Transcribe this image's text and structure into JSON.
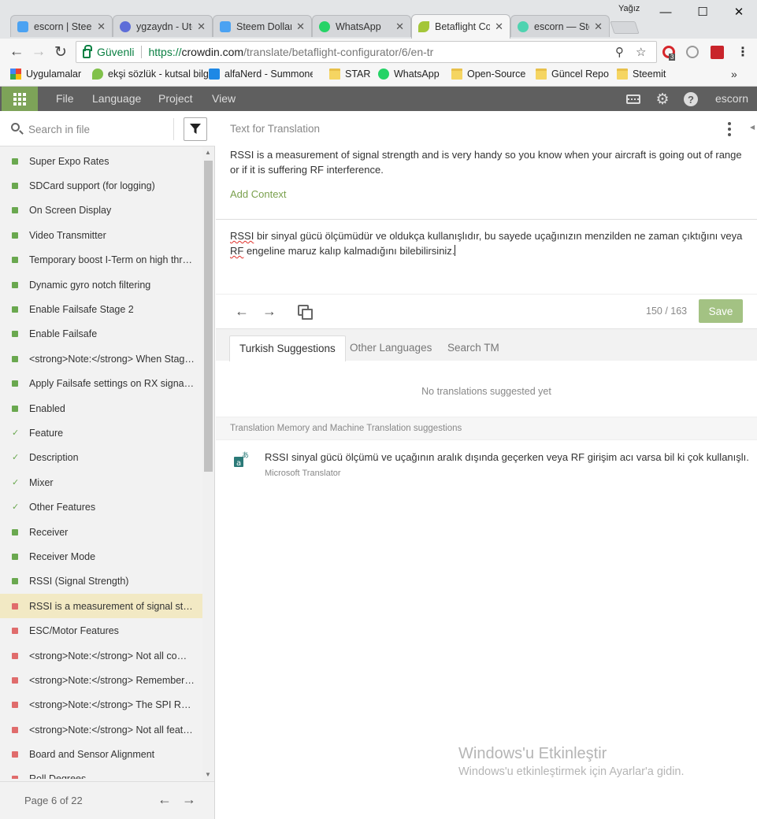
{
  "window": {
    "user": "Yağız",
    "controls": {
      "minimize": "—",
      "maximize": "☐",
      "close": "✕"
    }
  },
  "tabs": [
    {
      "label": "escorn | Steemit",
      "color": "#4ba2f2"
    },
    {
      "label": "ygzaydn - Utopian",
      "color": "#5d6dd8"
    },
    {
      "label": "Steem Dollars",
      "color": "#4ba2f2"
    },
    {
      "label": "WhatsApp",
      "color": "#25d366"
    },
    {
      "label": "Betaflight Configurator",
      "color": "#a4c639"
    },
    {
      "label": "escorn — Steemit",
      "color": "#4fd3b0"
    }
  ],
  "address_bar": {
    "secure_label": "Güvenli",
    "scheme": "https://",
    "host": "crowdin.com",
    "path": "/translate/betaflight-configurator/6/en-tr",
    "extension_badge": "3"
  },
  "bookmarks": [
    {
      "label": "Uygulamalar",
      "icon": "apps-icon"
    },
    {
      "label": "ekşi sözlük - kutsal bilgi",
      "icon": "eksi-icon"
    },
    {
      "label": "alfaNerd - Summoner",
      "icon": "alfanerd-icon"
    },
    {
      "label": "STAR",
      "icon": "folder-icon"
    },
    {
      "label": "WhatsApp",
      "icon": "whatsapp-icon"
    },
    {
      "label": "Open-Source",
      "icon": "folder-icon"
    },
    {
      "label": "Güncel Repo",
      "icon": "folder-icon"
    },
    {
      "label": "Steemit",
      "icon": "folder-icon"
    }
  ],
  "bookmarks_more": "»",
  "app_menu": [
    "File",
    "Language",
    "Project",
    "View"
  ],
  "app_user": "escorn",
  "sidebar": {
    "search_placeholder": "Search in file",
    "items": [
      {
        "label": "Super Expo Rates",
        "status": "green"
      },
      {
        "label": "SDCard support (for logging)",
        "status": "green"
      },
      {
        "label": "On Screen Display",
        "status": "green"
      },
      {
        "label": "Video Transmitter",
        "status": "green"
      },
      {
        "label": "Temporary boost I-Term on high throttle changes",
        "status": "green"
      },
      {
        "label": "Dynamic gyro notch filtering",
        "status": "green"
      },
      {
        "label": "Enable Failsafe Stage 2",
        "status": "green"
      },
      {
        "label": "Enable Failsafe",
        "status": "green"
      },
      {
        "label": "<strong>Note:</strong> When Stage 2 is",
        "status": "green"
      },
      {
        "label": "Apply Failsafe settings on RX signal loss",
        "status": "green"
      },
      {
        "label": "Enabled",
        "status": "green"
      },
      {
        "label": "Feature",
        "status": "check"
      },
      {
        "label": "Description",
        "status": "check"
      },
      {
        "label": "Mixer",
        "status": "check"
      },
      {
        "label": "Other Features",
        "status": "check"
      },
      {
        "label": "Receiver",
        "status": "green"
      },
      {
        "label": "Receiver Mode",
        "status": "green"
      },
      {
        "label": "RSSI (Signal Strength)",
        "status": "green"
      },
      {
        "label": "RSSI is a measurement of signal strength",
        "status": "red",
        "active": true
      },
      {
        "label": "ESC/Motor Features",
        "status": "red"
      },
      {
        "label": "<strong>Note:</strong> Not all combinations",
        "status": "red"
      },
      {
        "label": "<strong>Note:</strong> Remember to configure",
        "status": "red"
      },
      {
        "label": "<strong>Note:</strong> The SPI RX provider",
        "status": "red"
      },
      {
        "label": "<strong>Note:</strong> Not all features",
        "status": "red"
      },
      {
        "label": "Board and Sensor Alignment",
        "status": "red"
      },
      {
        "label": "Roll Degrees",
        "status": "red"
      }
    ],
    "pager": {
      "label": "Page 6 of 22"
    }
  },
  "editor": {
    "source_heading": "Text for Translation",
    "source_text": "RSSI is a measurement of signal strength and is very handy so you know when your aircraft is going out of range or if it is suffering RF interference.",
    "add_context": "Add Context",
    "translation_parts": {
      "w1": "RSSI",
      "mid": " bir sinyal gücü ölçümüdür ve oldukça kullanışlıdır, bu sayede uçağınızın menzilden ne zaman çıktığını veya ",
      "w2": "RF",
      "end": " engeline maruz kalıp kalmadığını bilebilirsiniz."
    },
    "counter": "150 / 163",
    "save_label": "Save"
  },
  "suggestions": {
    "tabs": [
      "Turkish Suggestions",
      "Other Languages",
      "Search TM"
    ],
    "active_tab": 0,
    "empty_message": "No translations suggested yet",
    "tm_heading": "Translation Memory and Machine Translation suggestions",
    "mt_result": {
      "text": "RSSI sinyal gücü ölçümü ve uçağının aralık dışında geçerken veya RF girişim acı varsa bil ki çok kullanışlı.",
      "source": "Microsoft Translator"
    }
  },
  "watermark": {
    "title": "Windows'u Etkinleştir",
    "subtitle": "Windows'u etkinleştirmek için Ayarlar'a gidin."
  },
  "colors": {
    "accent_green": "#7da358",
    "appbar": "#5f5f5f",
    "active_row": "#f2e9c4",
    "status_green": "#6aa84f",
    "status_red": "#e06c6c",
    "save_button": "#a3c283"
  }
}
